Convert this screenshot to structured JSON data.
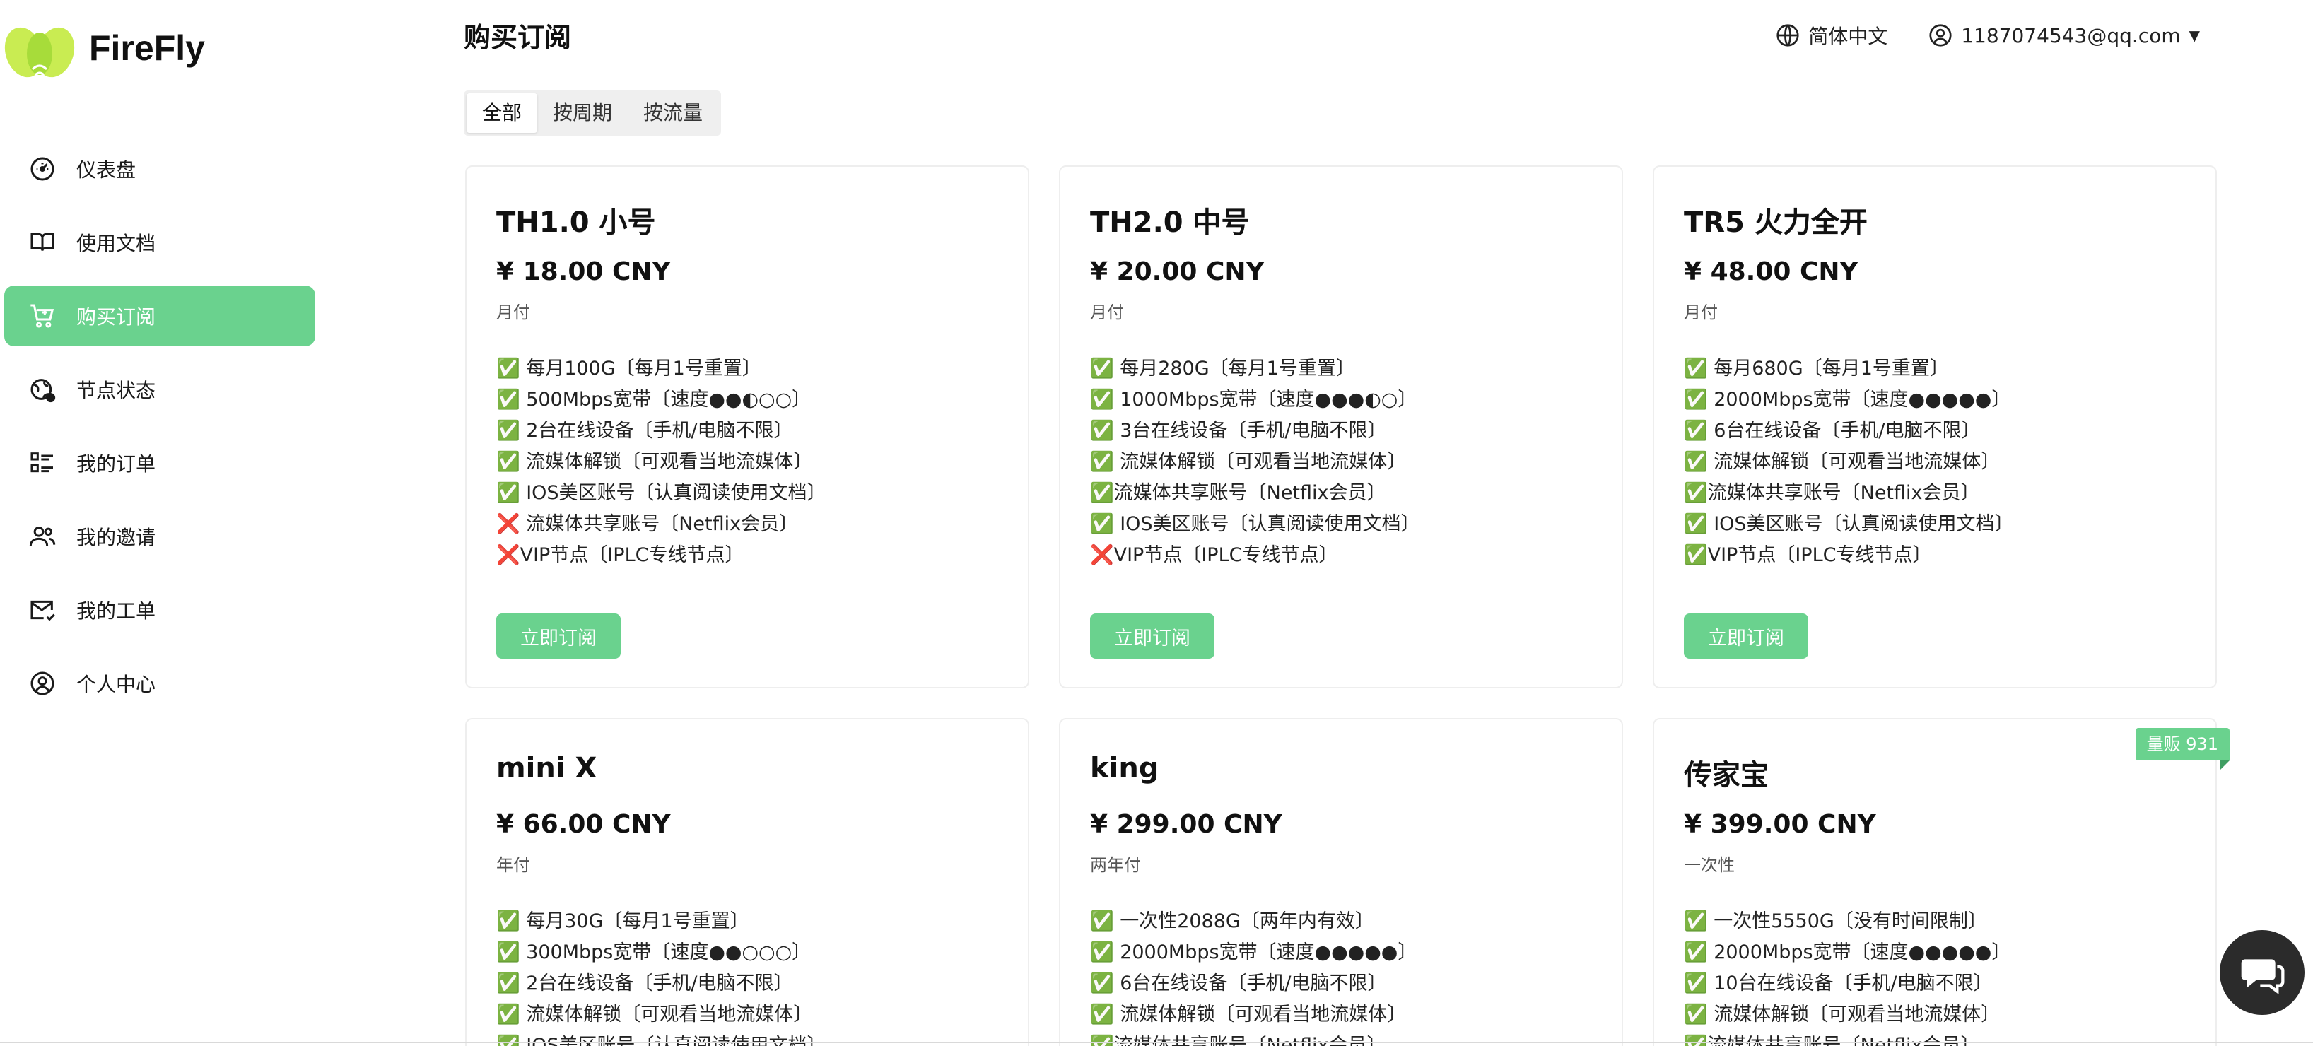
{
  "brand": {
    "name": "FireFly",
    "logo_colors": {
      "wings": "#c9ec52",
      "body": "#a7dc3a",
      "accent": "#ffffff"
    }
  },
  "sidebar": {
    "items": [
      {
        "label": "仪表盘",
        "icon": "dashboard-gauge-icon",
        "active": false
      },
      {
        "label": "使用文档",
        "icon": "book-open-icon",
        "active": false
      },
      {
        "label": "购买订阅",
        "icon": "shopping-cart-icon",
        "active": true
      },
      {
        "label": "节点状态",
        "icon": "globe-network-icon",
        "active": false
      },
      {
        "label": "我的订单",
        "icon": "list-icon",
        "active": false
      },
      {
        "label": "我的邀请",
        "icon": "users-icon",
        "active": false
      },
      {
        "label": "我的工单",
        "icon": "mail-ticket-icon",
        "active": false
      },
      {
        "label": "个人中心",
        "icon": "user-circle-icon",
        "active": false
      }
    ]
  },
  "header": {
    "title": "购买订阅",
    "language": "简体中文",
    "language_icon": "globe-icon",
    "user_email": "1187074543@qq.com",
    "user_icon": "user-circle-icon",
    "dropdown_icon": "caret-down-icon"
  },
  "tabs": [
    {
      "label": "全部",
      "active": true
    },
    {
      "label": "按周期",
      "active": false
    },
    {
      "label": "按流量",
      "active": false
    }
  ],
  "plans": [
    {
      "name": "TH1.0 小号",
      "price": "¥ 18.00 CNY",
      "period": "月付",
      "features": [
        "✅ 每月100G〔每月1号重置〕",
        "✅ 500Mbps宽带〔速度●●◐○○〕",
        "✅ 2台在线设备〔手机/电脑不限〕",
        "✅ 流媒体解锁〔可观看当地流媒体〕",
        "✅ IOS美区账号〔认真阅读使用文档〕",
        "❌ 流媒体共享账号〔Netflix会员〕",
        "❌VIP节点〔IPLC专线节点〕"
      ],
      "button": "立即订阅"
    },
    {
      "name": "TH2.0 中号",
      "price": "¥ 20.00 CNY",
      "period": "月付",
      "features": [
        "✅ 每月280G〔每月1号重置〕",
        "✅ 1000Mbps宽带〔速度●●●◐○〕",
        "✅ 3台在线设备〔手机/电脑不限〕",
        "✅ 流媒体解锁〔可观看当地流媒体〕",
        "✅流媒体共享账号〔Netflix会员〕",
        "✅ IOS美区账号〔认真阅读使用文档〕",
        "❌VIP节点〔IPLC专线节点〕"
      ],
      "button": "立即订阅"
    },
    {
      "name": "TR5 火力全开",
      "price": "¥ 48.00 CNY",
      "period": "月付",
      "features": [
        "✅ 每月680G〔每月1号重置〕",
        "✅ 2000Mbps宽带〔速度●●●●●〕",
        "✅ 6台在线设备〔手机/电脑不限〕",
        "✅ 流媒体解锁〔可观看当地流媒体〕",
        "✅流媒体共享账号〔Netflix会员〕",
        "✅ IOS美区账号〔认真阅读使用文档〕",
        "✅VIP节点〔IPLC专线节点〕"
      ],
      "button": "立即订阅"
    },
    {
      "name": "mini X",
      "price": "¥ 66.00 CNY",
      "period": "年付",
      "features": [
        "✅ 每月30G〔每月1号重置〕",
        "✅ 300Mbps宽带〔速度●●○○○〕",
        "✅ 2台在线设备〔手机/电脑不限〕",
        "✅ 流媒体解锁〔可观看当地流媒体〕",
        "✅ IOS美区账号〔认真阅读使用文档〕"
      ],
      "button": ""
    },
    {
      "name": "king",
      "price": "¥ 299.00 CNY",
      "period": "两年付",
      "features": [
        "✅ 一次性2088G〔两年内有效〕",
        "✅ 2000Mbps宽带〔速度●●●●●〕",
        "✅ 6台在线设备〔手机/电脑不限〕",
        "✅ 流媒体解锁〔可观看当地流媒体〕",
        "✅流媒体共享账号〔Netflix会员〕"
      ],
      "button": ""
    },
    {
      "name": "传家宝",
      "price": "¥ 399.00 CNY",
      "period": "一次性",
      "badge": "量贩 931",
      "features": [
        "✅ 一次性5550G〔没有时间限制〕",
        "✅ 2000Mbps宽带〔速度●●●●●〕",
        "✅ 10台在线设备〔手机/电脑不限〕",
        "✅ 流媒体解锁〔可观看当地流媒体〕",
        "✅流媒体共享账号〔Netflix会员〕"
      ],
      "button": ""
    }
  ],
  "chat": {
    "icon": "chat-bubble-icon"
  },
  "colors": {
    "accent": "#6ad28e",
    "active_nav_text": "#ffffff",
    "card_border": "#eeeeee",
    "tabs_bg": "#efefef",
    "chat_bg": "#2b2b2b"
  }
}
